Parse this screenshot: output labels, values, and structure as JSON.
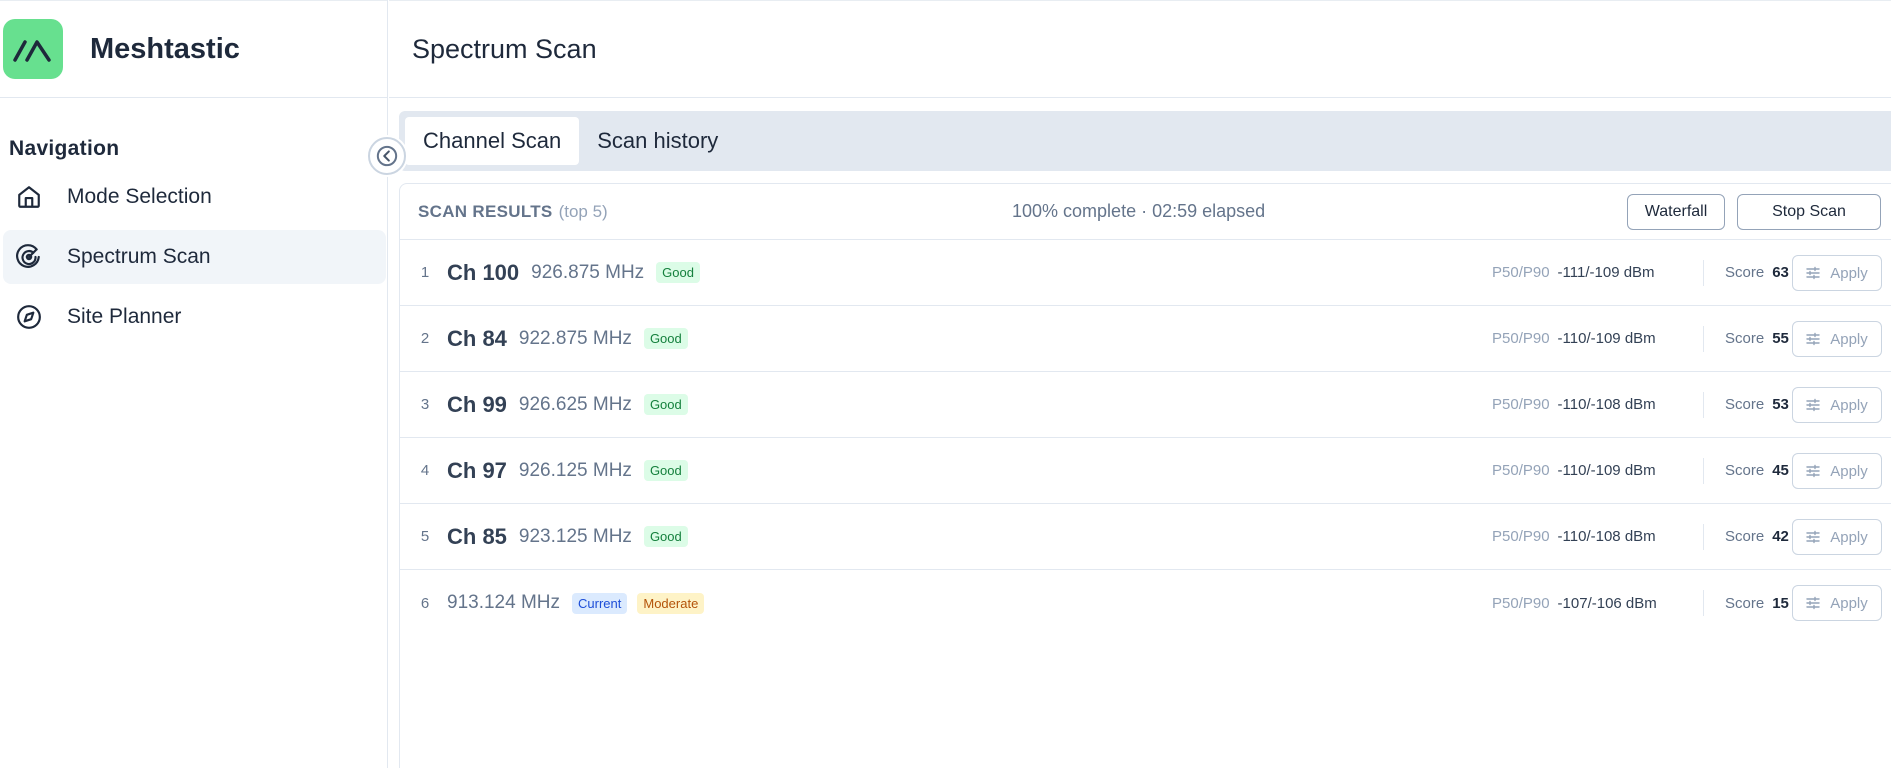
{
  "app": {
    "name": "Meshtastic"
  },
  "sidebar": {
    "title": "Navigation",
    "items": [
      {
        "label": "Mode Selection",
        "icon": "home-icon"
      },
      {
        "label": "Spectrum Scan",
        "icon": "radar-icon",
        "active": true
      },
      {
        "label": "Site Planner",
        "icon": "compass-icon"
      }
    ]
  },
  "page": {
    "title": "Spectrum Scan"
  },
  "tabs": [
    {
      "label": "Channel Scan",
      "active": true
    },
    {
      "label": "Scan history"
    }
  ],
  "results": {
    "title": "SCAN RESULTS",
    "subtitle": "(top 5)",
    "progress": "100% complete · 02:59 elapsed",
    "waterfall_label": "Waterfall",
    "stop_label": "Stop Scan",
    "metric_label": "P50/P90",
    "score_label": "Score",
    "apply_label": "Apply",
    "rows": [
      {
        "rank": "1",
        "channel": "Ch 100",
        "freq": "926.875 MHz",
        "badges": [
          "Good"
        ],
        "metric": "-111/-109 dBm",
        "score": "63"
      },
      {
        "rank": "2",
        "channel": "Ch 84",
        "freq": "922.875 MHz",
        "badges": [
          "Good"
        ],
        "metric": "-110/-109 dBm",
        "score": "55"
      },
      {
        "rank": "3",
        "channel": "Ch 99",
        "freq": "926.625 MHz",
        "badges": [
          "Good"
        ],
        "metric": "-110/-108 dBm",
        "score": "53"
      },
      {
        "rank": "4",
        "channel": "Ch 97",
        "freq": "926.125 MHz",
        "badges": [
          "Good"
        ],
        "metric": "-110/-109 dBm",
        "score": "45"
      },
      {
        "rank": "5",
        "channel": "Ch 85",
        "freq": "923.125 MHz",
        "badges": [
          "Good"
        ],
        "metric": "-110/-108 dBm",
        "score": "42"
      },
      {
        "rank": "6",
        "channel": "",
        "freq": "913.124 MHz",
        "badges": [
          "Current",
          "Moderate"
        ],
        "metric": "-107/-106 dBm",
        "score": "15"
      }
    ]
  },
  "colors": {
    "logo_bg": "#67e08f",
    "good": "#15803d",
    "current": "#1d4ed8",
    "moderate": "#b45309"
  }
}
